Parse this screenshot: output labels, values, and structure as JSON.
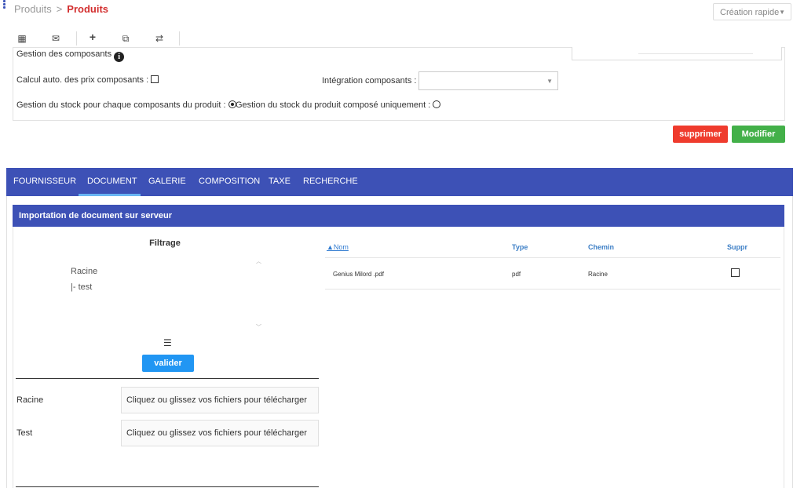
{
  "breadcrumb": {
    "parent": "Produits",
    "separator": ">",
    "current": "Produits"
  },
  "quick_create": {
    "label": "Création rapide"
  },
  "toolbar": {
    "items": [
      {
        "name": "calendar-icon",
        "glyph": "▦"
      },
      {
        "name": "envelope-icon",
        "glyph": "✉"
      },
      {
        "name": "plus-icon",
        "glyph": "+"
      },
      {
        "name": "copy-icon",
        "glyph": "⧉"
      },
      {
        "name": "swap-icon",
        "glyph": "⇄"
      }
    ]
  },
  "form": {
    "gestion_composants": "Gestion des composants",
    "info_glyph": "i",
    "calcul_auto": "Calcul auto. des prix composants :",
    "integration_label": "Intégration composants :",
    "integration_value": "",
    "stock_each": "Gestion du stock pour chaque composants du produit :",
    "stock_each_selected": true,
    "stock_composed": "Gestion du stock du produit composé uniquement :",
    "stock_composed_selected": false
  },
  "actions": {
    "delete": "supprimer",
    "modify": "Modifier"
  },
  "tabs": [
    {
      "label": "FOURNISSEUR",
      "active": false
    },
    {
      "label": "DOCUMENT",
      "active": true
    },
    {
      "label": "GALERIE",
      "active": false
    },
    {
      "label": "COMPOSITION",
      "active": false
    },
    {
      "label": "TAXE",
      "active": false
    },
    {
      "label": "RECHERCHE",
      "active": false
    }
  ],
  "section": {
    "title": "Importation de document sur serveur"
  },
  "filter": {
    "title": "Filtrage",
    "tree": [
      "Racine",
      "|- test"
    ],
    "validate": "valider"
  },
  "uploads": [
    {
      "folder": "Racine",
      "hint": "Cliquez ou glissez vos fichiers pour télécharger"
    },
    {
      "folder": "Test",
      "hint": "Cliquez ou glissez vos fichiers pour télécharger"
    }
  ],
  "table": {
    "headers": {
      "name": "▲Nom",
      "type": "Type",
      "path": "Chemin",
      "delete": "Suppr"
    },
    "rows": [
      {
        "name": "Genius Milord .pdf",
        "type": "pdf",
        "path": "Racine",
        "checked": false
      }
    ]
  },
  "colors": {
    "brand_blue": "#3d51b6",
    "delete_red": "#ef3b2d",
    "modify_green": "#43b049",
    "validate_blue": "#2196f3",
    "breadcrumb_red": "#d32f2f"
  }
}
